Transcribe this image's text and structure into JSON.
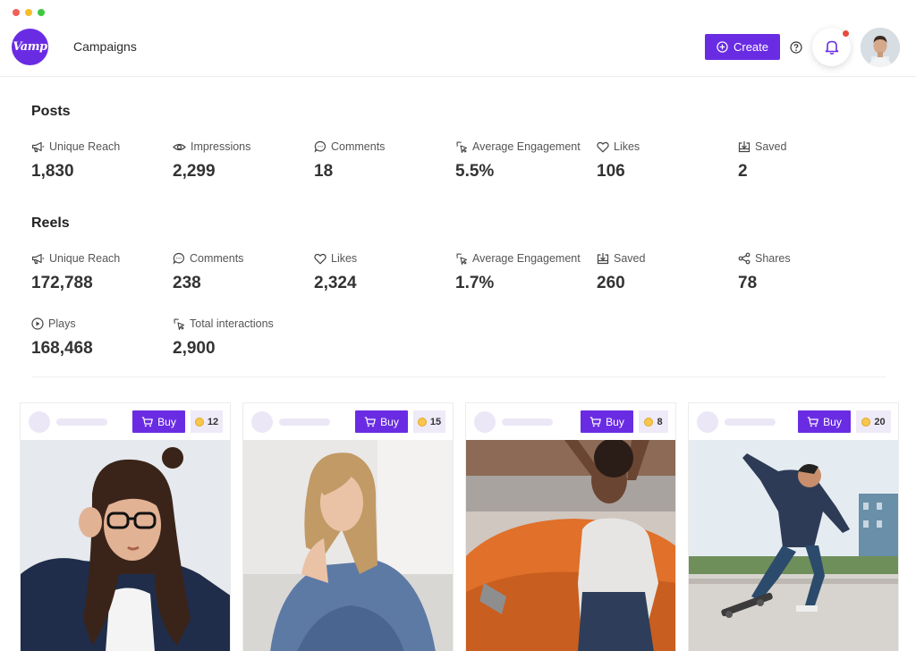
{
  "window": {
    "controls": [
      "close",
      "minimize",
      "maximize"
    ]
  },
  "header": {
    "logo_text": "Vamp",
    "nav_link": "Campaigns",
    "create_label": "Create",
    "icons": [
      "help-icon",
      "bell-icon",
      "avatar"
    ],
    "accent_color": "#6a2ce3"
  },
  "posts": {
    "title": "Posts",
    "stats": [
      {
        "icon": "megaphone-icon",
        "label": "Unique Reach",
        "value": "1,830"
      },
      {
        "icon": "eye-icon",
        "label": "Impressions",
        "value": "2,299"
      },
      {
        "icon": "comment-icon",
        "label": "Comments",
        "value": "18"
      },
      {
        "icon": "sparkle-click-icon",
        "label": "Average Engagement",
        "value": "5.5%"
      },
      {
        "icon": "heart-icon",
        "label": "Likes",
        "value": "106"
      },
      {
        "icon": "save-icon",
        "label": "Saved",
        "value": "2"
      }
    ]
  },
  "reels": {
    "title": "Reels",
    "stats": [
      {
        "icon": "megaphone-icon",
        "label": "Unique Reach",
        "value": "172,788"
      },
      {
        "icon": "comment-icon",
        "label": "Comments",
        "value": "238"
      },
      {
        "icon": "heart-icon",
        "label": "Likes",
        "value": "2,324"
      },
      {
        "icon": "sparkle-click-icon",
        "label": "Average Engagement",
        "value": "1.7%"
      },
      {
        "icon": "save-icon",
        "label": "Saved",
        "value": "260"
      },
      {
        "icon": "share-icon",
        "label": "Shares",
        "value": "78"
      },
      {
        "icon": "play-icon",
        "label": "Plays",
        "value": "168,468"
      },
      {
        "icon": "sparkle-click-icon",
        "label": "Total interactions",
        "value": "2,900"
      }
    ]
  },
  "cards": [
    {
      "buy_label": "Buy",
      "coins": "12",
      "photo": "woman-glasses-denim-jacket"
    },
    {
      "buy_label": "Buy",
      "coins": "15",
      "photo": "woman-denim-jacket-seated"
    },
    {
      "buy_label": "Buy",
      "coins": "8",
      "photo": "woman-orange-car"
    },
    {
      "buy_label": "Buy",
      "coins": "20",
      "photo": "skateboarder-jump"
    }
  ]
}
